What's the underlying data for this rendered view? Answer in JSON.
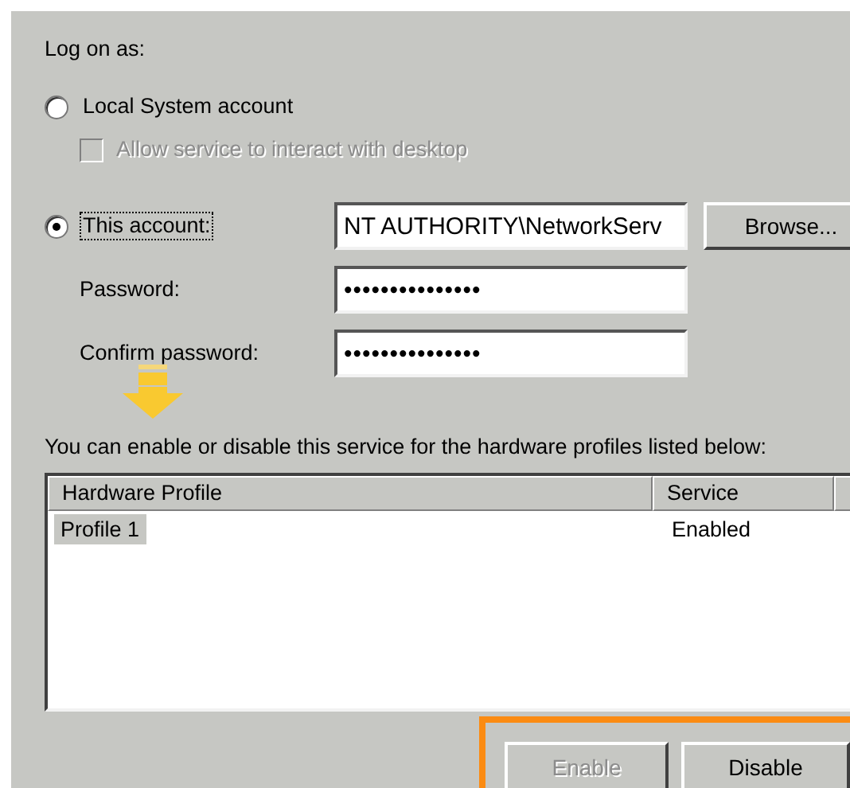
{
  "heading": "Log on as:",
  "options": [
    {
      "label": "Local System account",
      "selected": false
    },
    {
      "label": "This account:",
      "selected": true
    }
  ],
  "interact_checkbox": {
    "label": "Allow service to interact with desktop",
    "checked": false,
    "disabled": true
  },
  "account_field": {
    "value": "NT AUTHORITY\\NetworkServ"
  },
  "browse_button": "Browse...",
  "password": {
    "label": "Password:",
    "value": "•••••••••••••••"
  },
  "confirm_password": {
    "label": "Confirm password:",
    "value": "•••••••••••••••"
  },
  "profiles_caption": "You can enable or disable this service for the hardware profiles listed below:",
  "profiles_table": {
    "columns": [
      "Hardware Profile",
      "Service"
    ],
    "rows": [
      {
        "cells": [
          "Profile 1",
          "Enabled"
        ],
        "selected": true
      }
    ]
  },
  "buttons": [
    {
      "label": "Enable",
      "disabled": true
    },
    {
      "label": "Disable",
      "disabled": false
    }
  ]
}
